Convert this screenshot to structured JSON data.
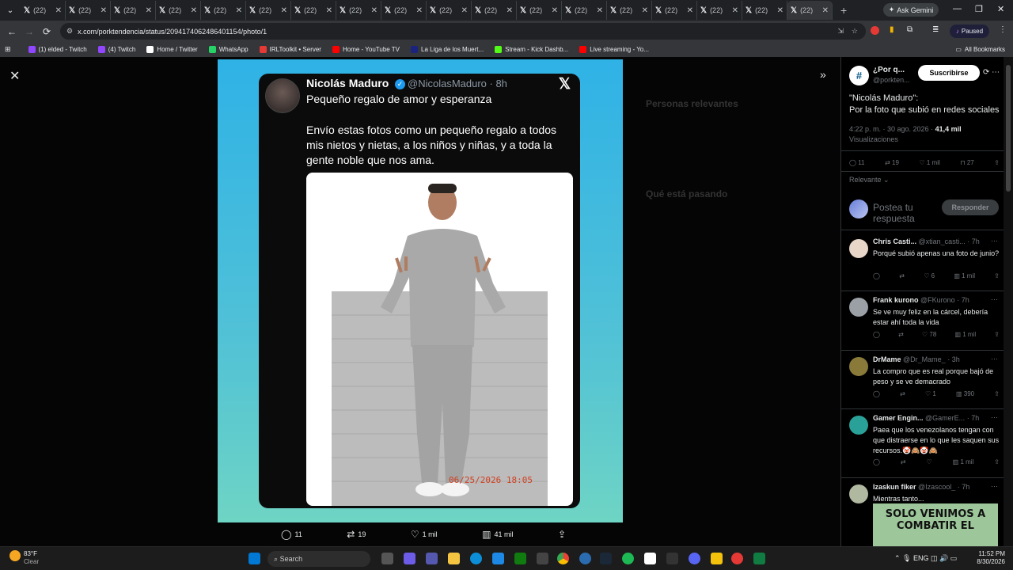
{
  "browser": {
    "tabs": [
      {
        "label": "(22)"
      },
      {
        "label": "(22)"
      },
      {
        "label": "(22)"
      },
      {
        "label": "(22)"
      },
      {
        "label": "(22)"
      },
      {
        "label": "(22)"
      },
      {
        "label": "(22)"
      },
      {
        "label": "(22)"
      },
      {
        "label": "(22)"
      },
      {
        "label": "(22)"
      },
      {
        "label": "(22)"
      },
      {
        "label": "(22)"
      },
      {
        "label": "(22)"
      },
      {
        "label": "(22)"
      },
      {
        "label": "(22)"
      },
      {
        "label": "(22)"
      },
      {
        "label": "(22)"
      },
      {
        "label": "(22)"
      }
    ],
    "ask_gemini": "Ask Gemini",
    "url": "x.com/porktendencia/status/2094174062486401154/photo/1",
    "profile_status": "Paused",
    "bookmarks": [
      {
        "label": "(1) elded - Twitch",
        "color": "#9146ff"
      },
      {
        "label": "(4) Twitch",
        "color": "#9146ff"
      },
      {
        "label": "Home / Twitter",
        "color": "#ffffff"
      },
      {
        "label": "WhatsApp",
        "color": "#25d366"
      },
      {
        "label": "IRLToolkit • Server",
        "color": "#e53935"
      },
      {
        "label": "Home - YouTube TV",
        "color": "#ff0000"
      },
      {
        "label": "La Liga de los Muert...",
        "color": "#1a237e"
      },
      {
        "label": "Stream - Kick Dashb...",
        "color": "#53fc18"
      },
      {
        "label": "Live streaming - Yo...",
        "color": "#ff0000"
      }
    ],
    "all_bookmarks": "All Bookmarks"
  },
  "photo_card": {
    "name": "Nicolás Maduro",
    "handle": "@NicolasMaduro · 8h",
    "line1": "Pequeño regalo de amor y esperanza",
    "body": "Envío estas fotos como un pequeño regalo a todos mis nietos y nietas, a los niños y niñas, y a toda la gente noble que nos ama.",
    "timestamp_stamp": "06/25/2026 18:05"
  },
  "photo_bar": {
    "replies": "11",
    "reposts": "19",
    "likes": "1 mil",
    "views": "41 mil"
  },
  "background_text": {
    "relevant_people": "Personas relevantes",
    "whats_happening": "Qué está pasando"
  },
  "post": {
    "account_name": "¿Por q...",
    "account_handle": "@porkten...",
    "subscribe": "Suscribirse",
    "text_line1": "\"Nicolás Maduro\":",
    "text_line2": "Por la foto que subió en redes sociales",
    "meta": "4:22 p. m. · 30 ago. 2026 ·",
    "views": "41,4 mil",
    "views_label": "Visualizaciones",
    "replies": "11",
    "reposts": "19",
    "likes": "1 mil",
    "bookmarks": "27",
    "sort": "Relevante",
    "reply_placeholder": "Postea tu respuesta",
    "reply_button": "Responder"
  },
  "replies": [
    {
      "name": "Chris Casti...",
      "handle": "@xtian_casti...",
      "time": "· 7h",
      "text": "Porqué subió apenas una foto de junio?",
      "reply_count": "",
      "repost_count": "",
      "like_count": "6",
      "view_count": "1 mil",
      "avatar_color": "#e8d6c8"
    },
    {
      "name": "Frank kurono",
      "handle": "@FKurono",
      "time": "· 7h",
      "text": "Se ve muy feliz en la cárcel, debería estar ahí toda la vida",
      "reply_count": "",
      "repost_count": "",
      "like_count": "78",
      "view_count": "1 mil",
      "avatar_color": "#9aa0a6"
    },
    {
      "name": "DrMame",
      "handle": "@Dr_Mame_",
      "time": "· 3h",
      "text": "La compro que es real porque bajó de peso y se ve demacrado",
      "reply_count": "",
      "repost_count": "",
      "like_count": "1",
      "view_count": "390",
      "avatar_color": "#8a7a3a"
    },
    {
      "name": "Gamer Engin...",
      "handle": "@GamerE...",
      "time": "· 7h",
      "text": "Paea que los venezolanos tengan con que distraerse en lo que les saquen sus recursos.🤡🙈🤡🙈",
      "reply_count": "",
      "repost_count": "",
      "like_count": "",
      "view_count": "1 mil",
      "avatar_color": "#2aa198"
    },
    {
      "name": "Izaskun fiker",
      "handle": "@Izascool_",
      "time": "· 7h",
      "text": "Mientras tanto...",
      "reply_count": "",
      "repost_count": "",
      "like_count": "",
      "view_count": "",
      "avatar_color": "#b0b8a0"
    }
  ],
  "meme_text": "SOLO VENIMOS A COMBATIR EL",
  "taskbar": {
    "temp": "83°F",
    "condition": "Clear",
    "search_placeholder": "Search",
    "lang": "ENG",
    "time": "11:52 PM",
    "date": "8/30/2026"
  }
}
